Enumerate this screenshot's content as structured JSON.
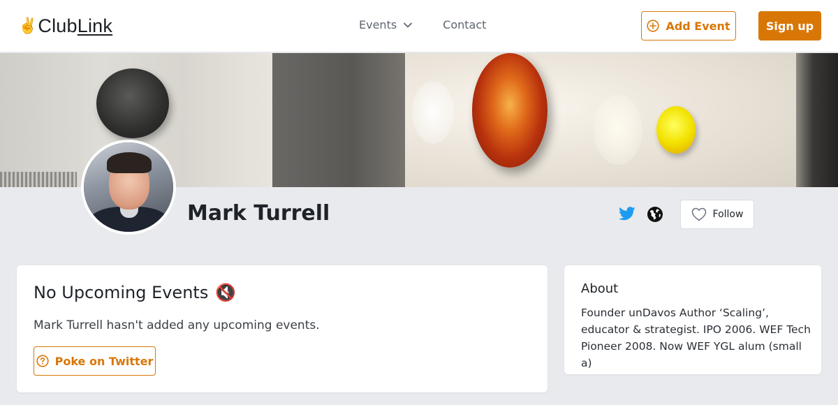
{
  "header": {
    "logo_hand": "✌️",
    "logo_text_a": "Club",
    "logo_text_b": "Link",
    "nav": {
      "events_label": "Events",
      "contact_label": "Contact"
    },
    "add_event_label": "Add Event",
    "sign_up_label": "Sign up"
  },
  "profile": {
    "name": "Mark Turrell",
    "social_icons": [
      "twitter-icon",
      "globe-icon"
    ],
    "follow_label": "Follow"
  },
  "events_card": {
    "title": "No Upcoming Events",
    "title_icon": "🔇",
    "message": "Mark Turrell hasn't added any upcoming events.",
    "poke_label": "Poke on Twitter"
  },
  "about_card": {
    "title": "About",
    "text": "Founder unDavos Author ‘Scaling’, educator & strategist. IPO 2006. WEF Tech Pioneer 2008. Now WEF YGL alum (small a)"
  },
  "colors": {
    "accent": "#d97706",
    "twitter": "#1d9bf0",
    "page_bg": "#e8eaee"
  }
}
